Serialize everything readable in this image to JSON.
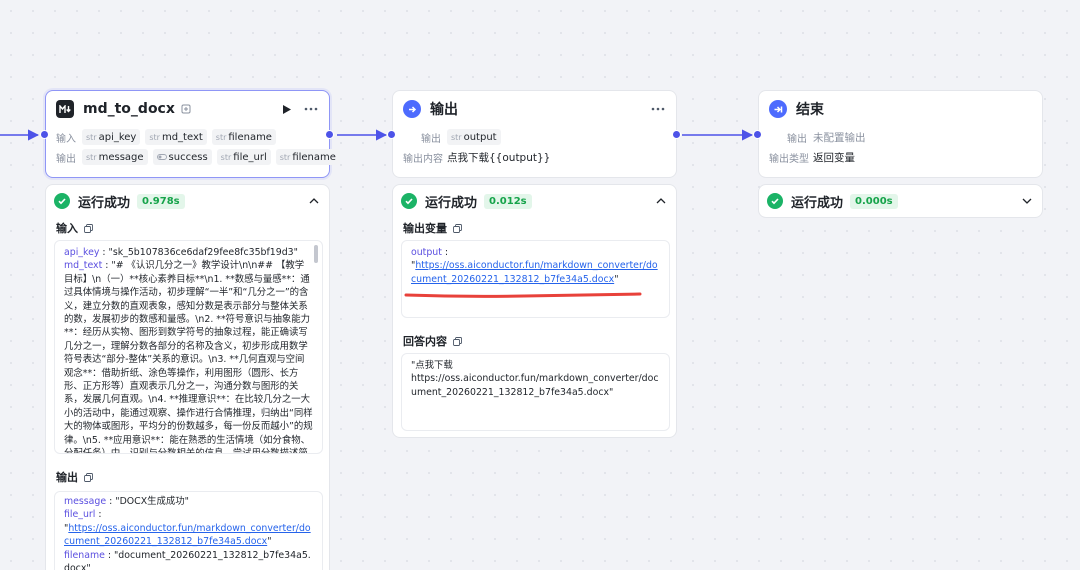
{
  "md_node": {
    "title": "md_to_docx",
    "input_label": "输入",
    "output_label": "输出",
    "inputs": [
      {
        "type": "str",
        "name": "api_key"
      },
      {
        "type": "str",
        "name": "md_text"
      },
      {
        "type": "str",
        "name": "filename"
      }
    ],
    "outputs": [
      {
        "type": "str",
        "name": "message"
      },
      {
        "type": "bool",
        "name": "success"
      },
      {
        "type": "str",
        "name": "file_url"
      },
      {
        "type": "str",
        "name": "filename"
      }
    ]
  },
  "output_node": {
    "title": "输出",
    "output_label": "输出",
    "output_var": {
      "type": "str",
      "name": "output"
    },
    "content_label": "输出内容",
    "content_value": "点我下载{{output}}"
  },
  "end_node": {
    "title": "结束",
    "output_label": "输出",
    "output_value": "未配置输出",
    "output_type_label": "输出类型",
    "output_type_value": "返回变量"
  },
  "md_run": {
    "status": "运行成功",
    "time": "0.978s",
    "input_title": "输入",
    "input_api_key_key": "api_key",
    "input_api_key_value": "\"sk_5b107836ce6daf29fee8fc35bf19d3\"",
    "input_md_text_key": "md_text",
    "input_md_text_value": "\"# 《认识几分之一》教学设计\\n\\n## 【教学目标】\\n（一）**核心素养目标**\\n1. **数感与量感**：通过具体情境与操作活动，初步理解“一半”和“几分之一”的含义，建立分数的直观表象，感知分数是表示部分与整体关系的数，发展初步的数感和量感。\\n2. **符号意识与抽象能力**：经历从实物、图形到数学符号的抽象过程，能正确读写几分之一，理解分数各部分的名称及含义，初步形成用数学符号表达“部分-整体”关系的意识。\\n3. **几何直观与空间观念**：借助折纸、涂色等操作，利用图形（圆形、长方形、正方形等）直观表示几分之一，沟通分数与图形的关系，发展几何直观。\\n4. **推理意识**：在比较几分之一大小的活动中，能通过观察、操作进行合情推理，归纳出“同样大的物体或图形，平均分的份数越多，每一份反而越小”的规律。\\n5. **应用意识**：能在熟悉的生活情境（如分食物、分配任务）中，识别与分数相关的信息，尝试用分数描述简单的生活现象，体会分数的应用价值。",
    "output_title": "输出",
    "output_message_key": "message",
    "output_message_value": "\"DOCX生成成功\"",
    "output_file_url_key": "file_url",
    "output_file_url_link": "https://oss.aiconductor.fun/markdown_converter/document_20260221_132812_b7fe34a5.docx",
    "output_filename_key": "filename",
    "output_filename_value": "\"document_20260221_132812_b7fe34a5.docx\""
  },
  "output_run": {
    "status": "运行成功",
    "time": "0.012s",
    "var_title": "输出变量",
    "var_key": "output",
    "var_link": "https://oss.aiconductor.fun/markdown_converter/document_20260221_132812_b7fe34a5.docx",
    "answer_title": "回答内容",
    "answer_line1": "\"点我下载",
    "answer_line2": "https://oss.aiconductor.fun/markdown_converter/document_20260221_132812_b7fe34a5.docx\""
  },
  "end_run": {
    "status": "运行成功",
    "time": "0.000s"
  },
  "colors": {
    "accent": "#4d53e8",
    "success": "#1bb366",
    "link": "#2563eb",
    "annotation": "#e8413a"
  }
}
